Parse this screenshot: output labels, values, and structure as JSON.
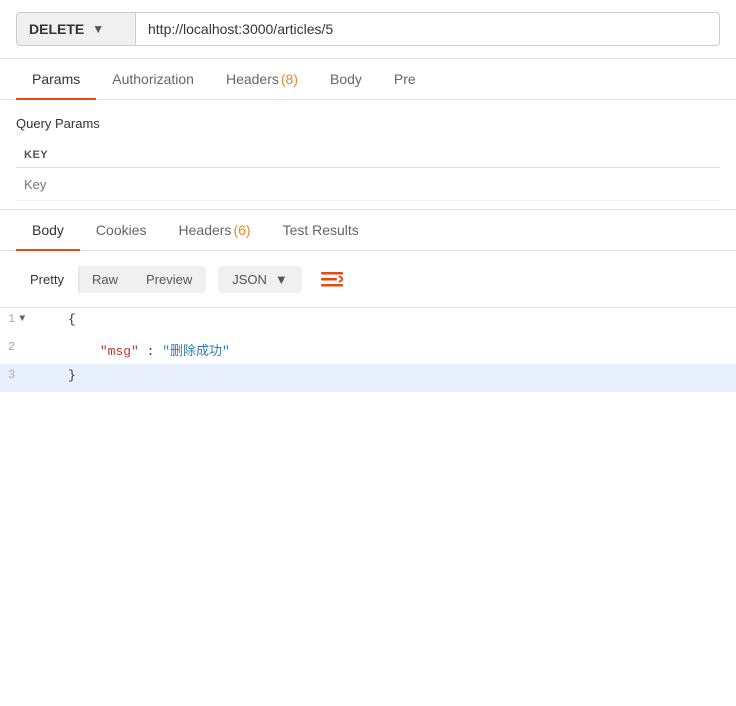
{
  "topbar": {
    "method": "DELETE",
    "url": "http://localhost:3000/articles/5"
  },
  "requestTabs": [
    {
      "label": "Params",
      "active": true
    },
    {
      "label": "Authorization",
      "active": false
    },
    {
      "label": "Headers",
      "active": false,
      "badge": "(8)"
    },
    {
      "label": "Body",
      "active": false
    },
    {
      "label": "Pre",
      "active": false
    }
  ],
  "queryParams": {
    "title": "Query Params",
    "columns": [
      "KEY"
    ],
    "keyPlaceholder": "Key"
  },
  "responseTabs": [
    {
      "label": "Body",
      "active": true
    },
    {
      "label": "Cookies",
      "active": false
    },
    {
      "label": "Headers",
      "active": false,
      "badge": "(6)"
    },
    {
      "label": "Test Results",
      "active": false
    }
  ],
  "responseToolbar": {
    "formats": [
      "Pretty",
      "Raw",
      "Preview"
    ],
    "activeFormat": "Pretty",
    "type": "JSON",
    "wrapIcon": "≡"
  },
  "codeLines": [
    {
      "number": "1",
      "toggle": true,
      "content": "{"
    },
    {
      "number": "2",
      "toggle": false,
      "content": "\"msg\":  \"删除成功\"",
      "hasKeyValue": true,
      "key": "\"msg\"",
      "colon": ": ",
      "value": "\"删除成功\""
    },
    {
      "number": "3",
      "toggle": false,
      "content": "}",
      "highlighted": true
    }
  ]
}
